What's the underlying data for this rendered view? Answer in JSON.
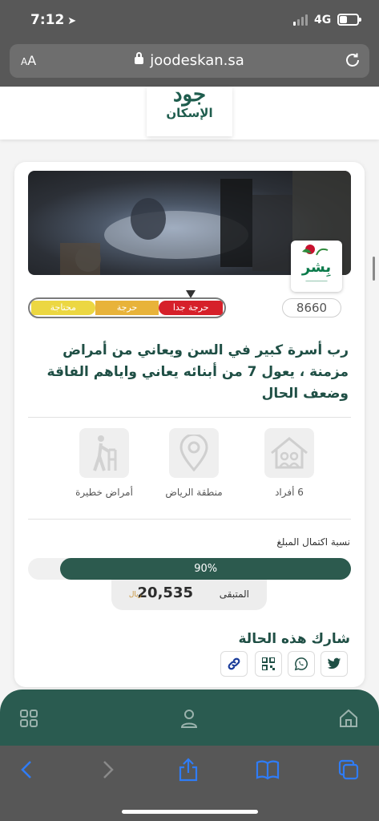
{
  "status": {
    "time": "7:12",
    "network": "4G"
  },
  "browser": {
    "aa_small": "A",
    "aa_large": "A",
    "url": "joodeskan.sa"
  },
  "site": {
    "logo_line1": "جود",
    "logo_line2": "الإسكان"
  },
  "case": {
    "partner_name": "بِشر",
    "need_levels": [
      "حرجة جدا",
      "حرجة",
      "محتاجة"
    ],
    "need_colors": [
      "#d6202a",
      "#e8b33a",
      "#ecd742"
    ],
    "case_id": "8660",
    "title": "رب أسرة كبير في السن ويعاني من أمراض مزمنة ، يعول 7 من أبنائه يعاني واياهم الفاقة وضعف الحال",
    "features": [
      {
        "icon": "family-house-icon",
        "label": "6 أفراد"
      },
      {
        "icon": "location-pin-icon",
        "label": "منطقة الرياض"
      },
      {
        "icon": "elderly-walker-icon",
        "label": "أمراض خطيرة"
      }
    ],
    "progress_title": "نسبة اكتمال المبلغ",
    "progress_percent": 90,
    "progress_label": "90%",
    "remaining_label": "المتبقى",
    "remaining_amount": "20,535",
    "currency": "ريال"
  },
  "share": {
    "title": "شارك هذه الحالة",
    "buttons": [
      "twitter-icon",
      "whatsapp-icon",
      "qr-code-icon",
      "link-icon"
    ]
  },
  "nav": {
    "items": [
      "home-icon",
      "user-icon",
      "grid-icon"
    ]
  },
  "toolbar": {
    "items": [
      "back-icon",
      "forward-icon",
      "share-icon",
      "bookmarks-icon",
      "tabs-icon"
    ]
  }
}
